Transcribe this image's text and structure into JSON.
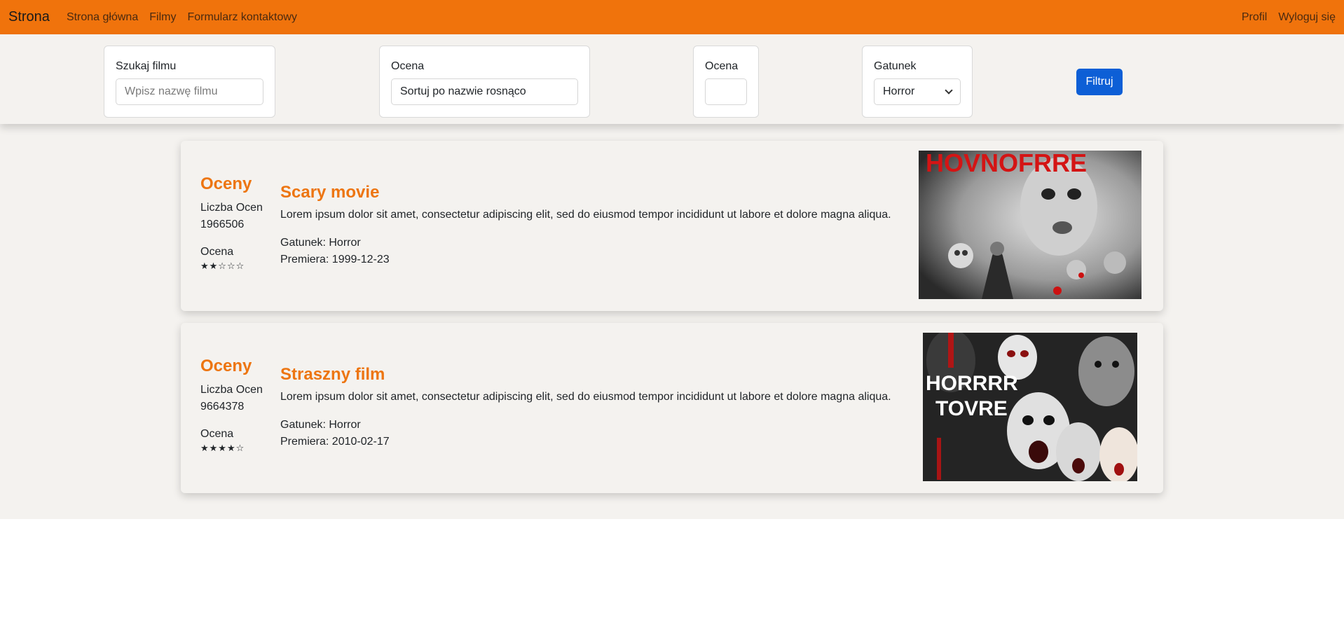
{
  "nav": {
    "brand": "Strona",
    "links": [
      "Strona główna",
      "Filmy",
      "Formularz kontaktowy"
    ],
    "right": [
      "Profil",
      "Wyloguj się"
    ]
  },
  "filters": {
    "search_label": "Szukaj filmu",
    "search_placeholder": "Wpisz nazwę filmu",
    "sort_label": "Ocena",
    "sort_value": "Sortuj po nazwie rosnąco",
    "rating_label": "Ocena",
    "rating_value": "",
    "genre_label": "Gatunek",
    "genre_value": "Horror",
    "filter_button": "Filtruj"
  },
  "movies": [
    {
      "ratings_heading": "Oceny",
      "count_label": "Liczba Ocen",
      "count": "1966506",
      "rating_label": "Ocena",
      "stars": "★★☆☆☆",
      "title": "Scary movie",
      "description": "Lorem ipsum dolor sit amet, consectetur adipiscing elit, sed do eiusmod tempor incididunt ut labore et dolore magna aliqua.",
      "genre": "Gatunek: Horror",
      "premiere": "Premiera: 1999-12-23",
      "poster_text": "HOVNOFRRE"
    },
    {
      "ratings_heading": "Oceny",
      "count_label": "Liczba Ocen",
      "count": "9664378",
      "rating_label": "Ocena",
      "stars": "★★★★☆",
      "title": "Straszny film",
      "description": "Lorem ipsum dolor sit amet, consectetur adipiscing elit, sed do eiusmod tempor incididunt ut labore et dolore magna aliqua.",
      "genre": "Gatunek: Horror",
      "premiere": "Premiera: 2010-02-17",
      "poster_text_1": "HORRRR",
      "poster_text_2": "TOVRE"
    }
  ],
  "colors": {
    "accent": "#f0730c",
    "title": "#ed7511",
    "button": "#0d5fd6"
  }
}
